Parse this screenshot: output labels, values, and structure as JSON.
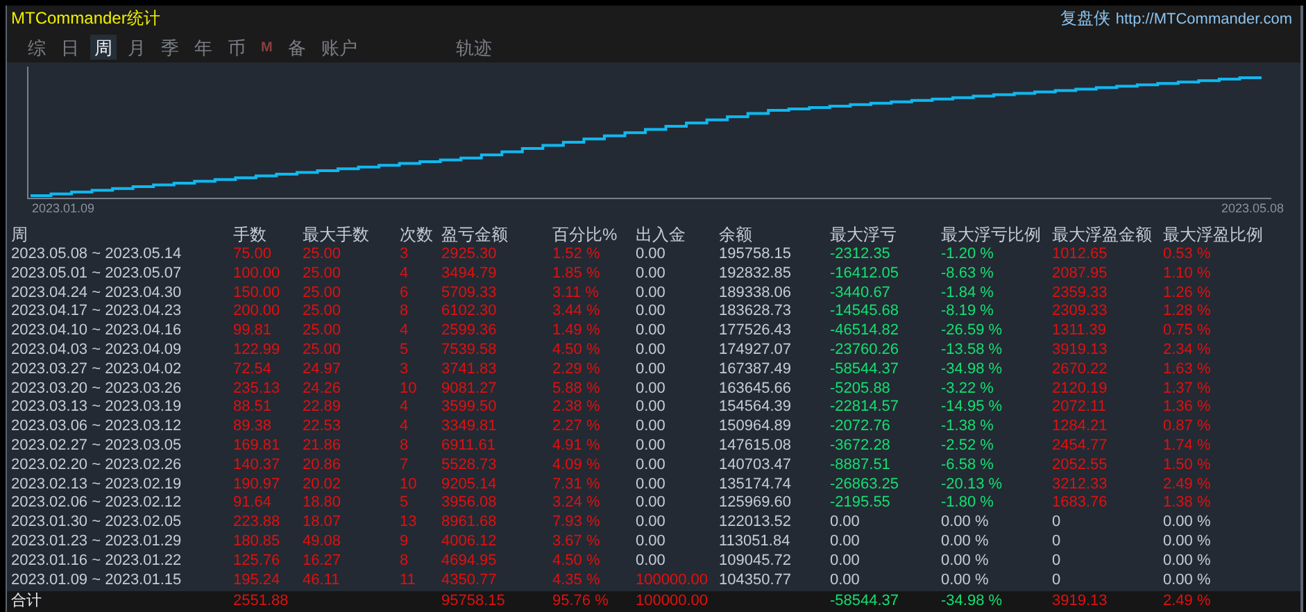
{
  "window": {
    "title": "MTCommander统计",
    "brand": "复盘侠",
    "url": "http://MTCommander.com"
  },
  "tabs": [
    {
      "label": "综",
      "selected": false
    },
    {
      "label": "日",
      "selected": false
    },
    {
      "label": "周",
      "selected": true
    },
    {
      "label": "月",
      "selected": false
    },
    {
      "label": "季",
      "selected": false
    },
    {
      "label": "年",
      "selected": false
    },
    {
      "label": "币",
      "selected": false
    },
    {
      "label": "M",
      "selected": false
    },
    {
      "label": "备",
      "selected": false
    },
    {
      "label": "账户",
      "selected": false
    },
    {
      "label": "轨迹",
      "selected": false
    }
  ],
  "chart": {
    "start_label": "2023.01.09",
    "end_label": "2023.05.08"
  },
  "table": {
    "columns": [
      {
        "label": "周",
        "color": "#c4ccd8"
      },
      {
        "label": "手数",
        "color": "#e01010"
      },
      {
        "label": "最大手数",
        "color": "#e01010"
      },
      {
        "label": "次数",
        "color": "#e01010"
      },
      {
        "label": "盈亏金额",
        "color": "#e01010"
      },
      {
        "label": "百分比%",
        "color": "#e01010"
      },
      {
        "label": "出入金",
        "color": "#e01010"
      },
      {
        "label": "余额",
        "color": "#c4ccd8"
      },
      {
        "label": "最大浮亏",
        "color": "#12e070"
      },
      {
        "label": "最大浮亏比例",
        "color": "#12e070"
      },
      {
        "label": "最大浮盈金额",
        "color": "#e01010"
      },
      {
        "label": "最大浮盈比例",
        "color": "#e01010"
      }
    ],
    "rows": [
      {
        "cells": [
          "2023.05.08 ~ 2023.05.14",
          "75.00",
          "25.00",
          "3",
          "2925.30",
          "1.52 %",
          "0.00",
          "195758.15",
          "-2312.35",
          "-1.20 %",
          "1012.65",
          "0.53 %"
        ],
        "deposit_active": false,
        "floating_active": true
      },
      {
        "cells": [
          "2023.05.01 ~ 2023.05.07",
          "100.00",
          "25.00",
          "4",
          "3494.79",
          "1.85 %",
          "0.00",
          "192832.85",
          "-16412.05",
          "-8.63 %",
          "2087.95",
          "1.10 %"
        ],
        "deposit_active": false,
        "floating_active": true
      },
      {
        "cells": [
          "2023.04.24 ~ 2023.04.30",
          "150.00",
          "25.00",
          "6",
          "5709.33",
          "3.11 %",
          "0.00",
          "189338.06",
          "-3440.67",
          "-1.84 %",
          "2359.33",
          "1.26 %"
        ],
        "deposit_active": false,
        "floating_active": true
      },
      {
        "cells": [
          "2023.04.17 ~ 2023.04.23",
          "200.00",
          "25.00",
          "8",
          "6102.30",
          "3.44 %",
          "0.00",
          "183628.73",
          "-14545.68",
          "-8.19 %",
          "2309.33",
          "1.28 %"
        ],
        "deposit_active": false,
        "floating_active": true
      },
      {
        "cells": [
          "2023.04.10 ~ 2023.04.16",
          "99.81",
          "25.00",
          "4",
          "2599.36",
          "1.49 %",
          "0.00",
          "177526.43",
          "-46514.82",
          "-26.59 %",
          "1311.39",
          "0.75 %"
        ],
        "deposit_active": false,
        "floating_active": true
      },
      {
        "cells": [
          "2023.04.03 ~ 2023.04.09",
          "122.99",
          "25.00",
          "5",
          "7539.58",
          "4.50 %",
          "0.00",
          "174927.07",
          "-23760.26",
          "-13.58 %",
          "3919.13",
          "2.34 %"
        ],
        "deposit_active": false,
        "floating_active": true
      },
      {
        "cells": [
          "2023.03.27 ~ 2023.04.02",
          "72.54",
          "24.97",
          "3",
          "3741.83",
          "2.29 %",
          "0.00",
          "167387.49",
          "-58544.37",
          "-34.98 %",
          "2670.22",
          "1.63 %"
        ],
        "deposit_active": false,
        "floating_active": true
      },
      {
        "cells": [
          "2023.03.20 ~ 2023.03.26",
          "235.13",
          "24.26",
          "10",
          "9081.27",
          "5.88 %",
          "0.00",
          "163645.66",
          "-5205.88",
          "-3.22 %",
          "2120.19",
          "1.37 %"
        ],
        "deposit_active": false,
        "floating_active": true
      },
      {
        "cells": [
          "2023.03.13 ~ 2023.03.19",
          "88.51",
          "22.89",
          "4",
          "3599.50",
          "2.38 %",
          "0.00",
          "154564.39",
          "-22814.57",
          "-14.95 %",
          "2072.11",
          "1.36 %"
        ],
        "deposit_active": false,
        "floating_active": true
      },
      {
        "cells": [
          "2023.03.06 ~ 2023.03.12",
          "89.38",
          "22.53",
          "4",
          "3349.81",
          "2.27 %",
          "0.00",
          "150964.89",
          "-2072.76",
          "-1.38 %",
          "1284.21",
          "0.87 %"
        ],
        "deposit_active": false,
        "floating_active": true
      },
      {
        "cells": [
          "2023.02.27 ~ 2023.03.05",
          "169.81",
          "21.86",
          "8",
          "6911.61",
          "4.91 %",
          "0.00",
          "147615.08",
          "-3672.28",
          "-2.52 %",
          "2454.77",
          "1.74 %"
        ],
        "deposit_active": false,
        "floating_active": true
      },
      {
        "cells": [
          "2023.02.20 ~ 2023.02.26",
          "140.37",
          "20.86",
          "7",
          "5528.73",
          "4.09 %",
          "0.00",
          "140703.47",
          "-8887.51",
          "-6.58 %",
          "2052.55",
          "1.50 %"
        ],
        "deposit_active": false,
        "floating_active": true
      },
      {
        "cells": [
          "2023.02.13 ~ 2023.02.19",
          "190.97",
          "20.02",
          "10",
          "9205.14",
          "7.31 %",
          "0.00",
          "135174.74",
          "-26863.25",
          "-20.13 %",
          "3212.33",
          "2.49 %"
        ],
        "deposit_active": false,
        "floating_active": true
      },
      {
        "cells": [
          "2023.02.06 ~ 2023.02.12",
          "91.64",
          "18.80",
          "5",
          "3956.08",
          "3.24 %",
          "0.00",
          "125969.60",
          "-2195.55",
          "-1.80 %",
          "1683.76",
          "1.38 %"
        ],
        "deposit_active": false,
        "floating_active": true
      },
      {
        "cells": [
          "2023.01.30 ~ 2023.02.05",
          "223.88",
          "18.07",
          "13",
          "8961.68",
          "7.93 %",
          "0.00",
          "122013.52",
          "0.00",
          "0.00 %",
          "0",
          "0.00 %"
        ],
        "deposit_active": false,
        "floating_active": false
      },
      {
        "cells": [
          "2023.01.23 ~ 2023.01.29",
          "180.85",
          "49.08",
          "9",
          "4006.12",
          "3.67 %",
          "0.00",
          "113051.84",
          "0.00",
          "0.00 %",
          "0",
          "0.00 %"
        ],
        "deposit_active": false,
        "floating_active": false
      },
      {
        "cells": [
          "2023.01.16 ~ 2023.01.22",
          "125.76",
          "16.27",
          "8",
          "4694.95",
          "4.50 %",
          "0.00",
          "109045.72",
          "0.00",
          "0.00 %",
          "0",
          "0.00 %"
        ],
        "deposit_active": false,
        "floating_active": false
      },
      {
        "cells": [
          "2023.01.09 ~ 2023.01.15",
          "195.24",
          "46.11",
          "11",
          "4350.77",
          "4.35 %",
          "100000.00",
          "104350.77",
          "0.00",
          "0.00 %",
          "0",
          "0.00 %"
        ],
        "deposit_active": true,
        "floating_active": false
      }
    ],
    "total": {
      "cells": [
        "合计",
        "2551.88",
        null,
        null,
        "95758.15",
        "95.76 %",
        "100000.00",
        null,
        "-58544.37",
        "-34.98 %",
        "3919.13",
        "2.49 %"
      ]
    }
  }
}
